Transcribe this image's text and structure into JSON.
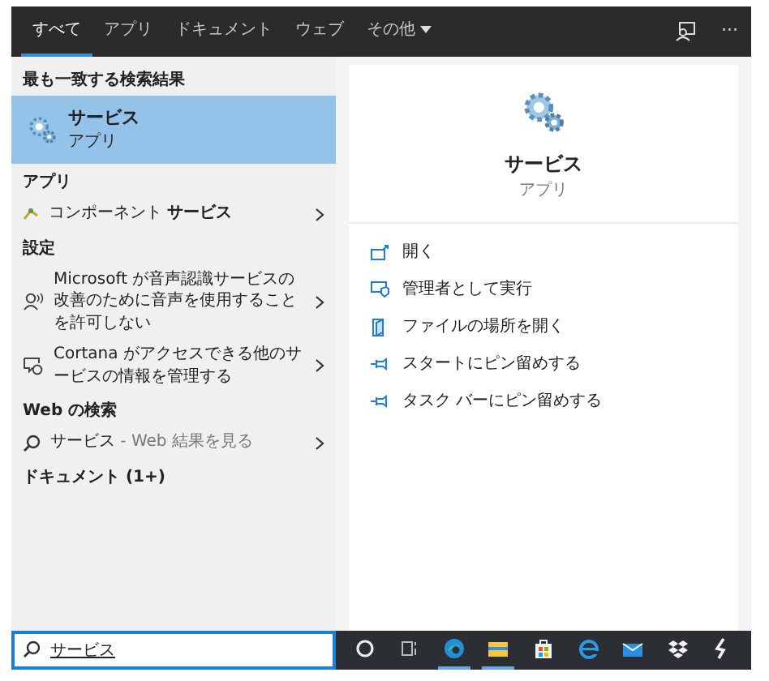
{
  "tabs": [
    {
      "label": "すべて",
      "selected": true,
      "dropdown": false
    },
    {
      "label": "アプリ",
      "selected": false,
      "dropdown": false
    },
    {
      "label": "ドキュメント",
      "selected": false,
      "dropdown": false
    },
    {
      "label": "ウェブ",
      "selected": false,
      "dropdown": false
    },
    {
      "label": "その他",
      "selected": false,
      "dropdown": true
    }
  ],
  "header_more": "···",
  "sections": [
    {
      "heading": "最も一致する検索結果",
      "items": [
        {
          "kind": "best",
          "title": "サービス",
          "subtitle": "アプリ",
          "selected": true
        }
      ]
    },
    {
      "heading": "アプリ",
      "items": [
        {
          "kind": "row",
          "title": "コンポーネント **サービス**",
          "selected": false
        }
      ]
    },
    {
      "heading": "設定",
      "items": [
        {
          "kind": "row",
          "title": "Microsoft が音声認識サービスの改善のために音声を使用することを許可しない",
          "selected": false
        },
        {
          "kind": "row",
          "title": "Cortana がアクセスできる他のサービスの情報を管理する",
          "selected": false
        }
      ]
    },
    {
      "heading": "Web の検索",
      "items": [
        {
          "kind": "row",
          "title": "サービス",
          "hint": " - Web 結果を見る",
          "selected": false
        }
      ]
    },
    {
      "heading": "ドキュメント (1+)"
    }
  ],
  "preview": {
    "title": "サービス",
    "subtitle": "アプリ",
    "actions": [
      {
        "label": "開く"
      },
      {
        "label": "管理者として実行"
      },
      {
        "label": "ファイルの場所を開く"
      },
      {
        "label": "スタートにピン留めする"
      },
      {
        "label": "タスク バーにピン留めする"
      }
    ]
  },
  "search": {
    "value": "サービス"
  },
  "taskbar": [
    {
      "running": false
    },
    {
      "running": false
    },
    {
      "running": true
    },
    {
      "running": true
    },
    {
      "running": false
    },
    {
      "running": false
    },
    {
      "running": false
    },
    {
      "running": false
    },
    {
      "running": false
    }
  ]
}
